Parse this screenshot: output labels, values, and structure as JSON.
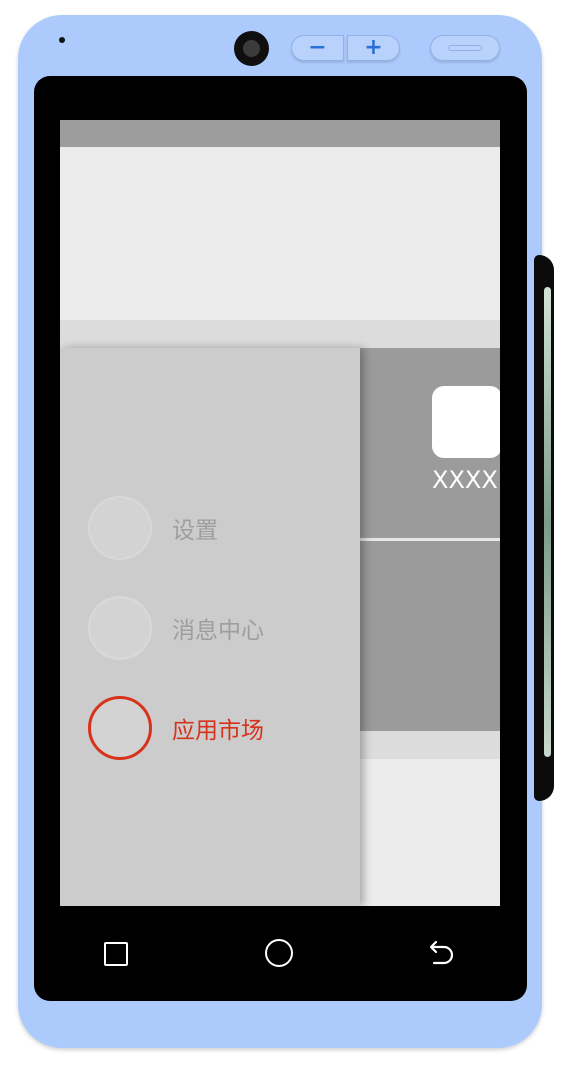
{
  "device": {
    "body_color": "#adcafd",
    "bezel_color": "#000000",
    "hardware_buttons": {
      "volume_down_label": "−",
      "volume_up_label": "+"
    },
    "icons": [
      "camera-icon",
      "speaker-icon",
      "power-icon"
    ]
  },
  "screen": {
    "status_bar_color": "#9d9d9d",
    "content": {
      "app_name": "XXXX",
      "app_tile_color": "#ffffff"
    }
  },
  "drawer": {
    "background": "#cccccc",
    "active_color": "#d7321c",
    "inactive_color": "#9e9e9e",
    "items": [
      {
        "label": "设置",
        "icon": "settings-circle-icon",
        "active": false
      },
      {
        "label": "消息中心",
        "icon": "message-circle-icon",
        "active": false
      },
      {
        "label": "应用市场",
        "icon": "app-market-circle-icon",
        "active": true
      }
    ]
  },
  "nav_bar": {
    "icons": [
      "recent-apps-icon",
      "home-icon",
      "back-icon"
    ]
  }
}
